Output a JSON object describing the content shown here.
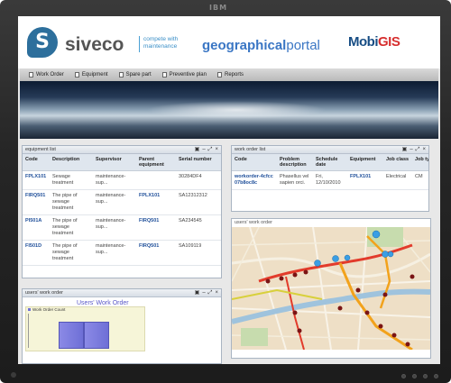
{
  "bezel": {
    "brand": "IBM"
  },
  "header": {
    "logo_letter": "S",
    "brand_name": "siveco",
    "tagline": "compete with maintenance",
    "portal_title_prefix": "geographical",
    "portal_title_suffix": "portal",
    "partner_logo_a": "Mobi",
    "partner_logo_b": "GIS"
  },
  "nav": {
    "items": [
      {
        "label": "Work Order",
        "icon": "page-icon"
      },
      {
        "label": "Equipment",
        "icon": "page-icon"
      },
      {
        "label": "Spare part",
        "icon": "page-icon"
      },
      {
        "label": "Preventive plan",
        "icon": "page-icon"
      },
      {
        "label": "Reports",
        "icon": "report-icon"
      }
    ]
  },
  "equipment_list": {
    "title": "equipment list",
    "tools": [
      "▣",
      "–",
      "⤢",
      "×"
    ],
    "columns": [
      "Code",
      "Description",
      "Supervisor",
      "Parent equipment",
      "Serial number"
    ],
    "rows": [
      [
        "FPLX101",
        "Sewage treatment",
        "maintenance-sup...",
        "",
        "30284DF4"
      ],
      [
        "FIRQ501",
        "The pipe of sewage treatment",
        "maintenance-sup...",
        "FPLX101",
        "SA12312312"
      ],
      [
        "PI501A",
        "The pipe of sewage treatment",
        "maintenance-sup...",
        "FIRQ501",
        "SA234545"
      ],
      [
        "FI501D",
        "The pipe of sewage treatment",
        "maintenance-sup...",
        "FIRQ501",
        "SA109119"
      ]
    ]
  },
  "work_order_list": {
    "title": "work order list",
    "tools": [
      "▣",
      "–",
      "⤢",
      "×"
    ],
    "columns": [
      "Code",
      "Problem description",
      "Schedule date",
      "Equipment",
      "Job class",
      "Job typ"
    ],
    "rows": [
      [
        "workorder-4cfcc07b8oc8c",
        "Phasellus vel sapien orci.",
        "Fri, 12/10/2010",
        "FPLX101",
        "Electrical",
        "CM"
      ]
    ]
  },
  "users_work_order_map": {
    "title": "users' work order"
  },
  "users_work_order_chart": {
    "title": "users' work order",
    "tools": [
      "▣",
      "–",
      "⤢",
      "×"
    ]
  },
  "chart_data": {
    "type": "bar",
    "title": "Users' Work Order",
    "series": [
      {
        "name": "Work Order Count",
        "values": [
          2,
          2
        ]
      }
    ],
    "categories": [
      "",
      ""
    ],
    "xlabel": "",
    "ylabel": "",
    "legend": "top-left",
    "colors": [
      "#7273dc"
    ]
  }
}
